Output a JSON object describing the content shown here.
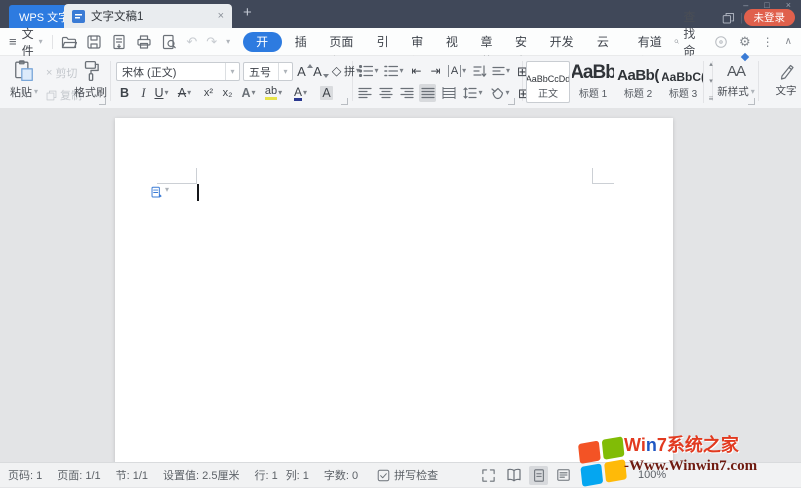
{
  "titlebar": {
    "app_button": "WPS 文字",
    "tab_title": "文字文稿1",
    "login_badge": "未登录"
  },
  "menubar": {
    "file_label": "文件",
    "tabs": [
      "开始",
      "插入",
      "页面布局",
      "引用",
      "审阅",
      "视图",
      "章节",
      "安全",
      "开发工具",
      "云服务",
      "有道翻译"
    ],
    "active_tab": "开始",
    "search_label": "查找命令"
  },
  "ribbon": {
    "clipboard": {
      "paste": "粘贴",
      "cut": "剪切",
      "copy": "复制",
      "painter": "格式刷"
    },
    "font": {
      "family": "宋体 (正文)",
      "size": "五号",
      "grow": "A",
      "shrink": "A",
      "phonetic": "拼",
      "bold": "B",
      "italic": "I",
      "underline": "U",
      "strike": "A",
      "superscript": "x²",
      "subscript": "x₂",
      "effects": "A",
      "highlight": "ab",
      "color": "A",
      "char_shading": "A"
    },
    "paragraph": {
      "cjk": "A"
    },
    "styles": {
      "cells": [
        {
          "preview": "AaBbCcDd",
          "label": "正文"
        },
        {
          "preview": "AaBb",
          "label": "标题 1"
        },
        {
          "preview": "AaBb(",
          "label": "标题 2"
        },
        {
          "preview": "AaBbC(",
          "label": "标题 3"
        }
      ],
      "new_icon": "AA",
      "new_label": "新样式",
      "text_tool": "文字"
    }
  },
  "statusbar": {
    "page": "页码: 1",
    "pages": "页面: 1/1",
    "section": "节: 1/1",
    "setting": "设置值: 2.5厘米",
    "line": "行: 1",
    "column": "列: 1",
    "words": "字数: 0",
    "spellcheck": "拼写检查",
    "zoom": "100%"
  },
  "watermark": {
    "w1": "Wi",
    "w2": "n",
    "w3": "7",
    "w4": "系统之家",
    "url": "-Www.Winwin7.com"
  },
  "icons": {
    "hamburger": "≡",
    "caret": "▾",
    "undo": "↶",
    "redo": "↷",
    "gear": "⚙",
    "dots": "⋮",
    "collapse": "∧",
    "min": "–",
    "max": "□",
    "close": "×",
    "plus": "+",
    "cut": "×",
    "clear_format": "◇",
    "outdent": "⇤",
    "indent": "⇥",
    "table": "⊞",
    "borders": "⊞",
    "up": "▴",
    "down": "▾",
    "menu": "≡"
  },
  "colors": {
    "accent_blue": "#2d7be0",
    "login_red": "#e0604c",
    "titlebar": "#404859"
  }
}
